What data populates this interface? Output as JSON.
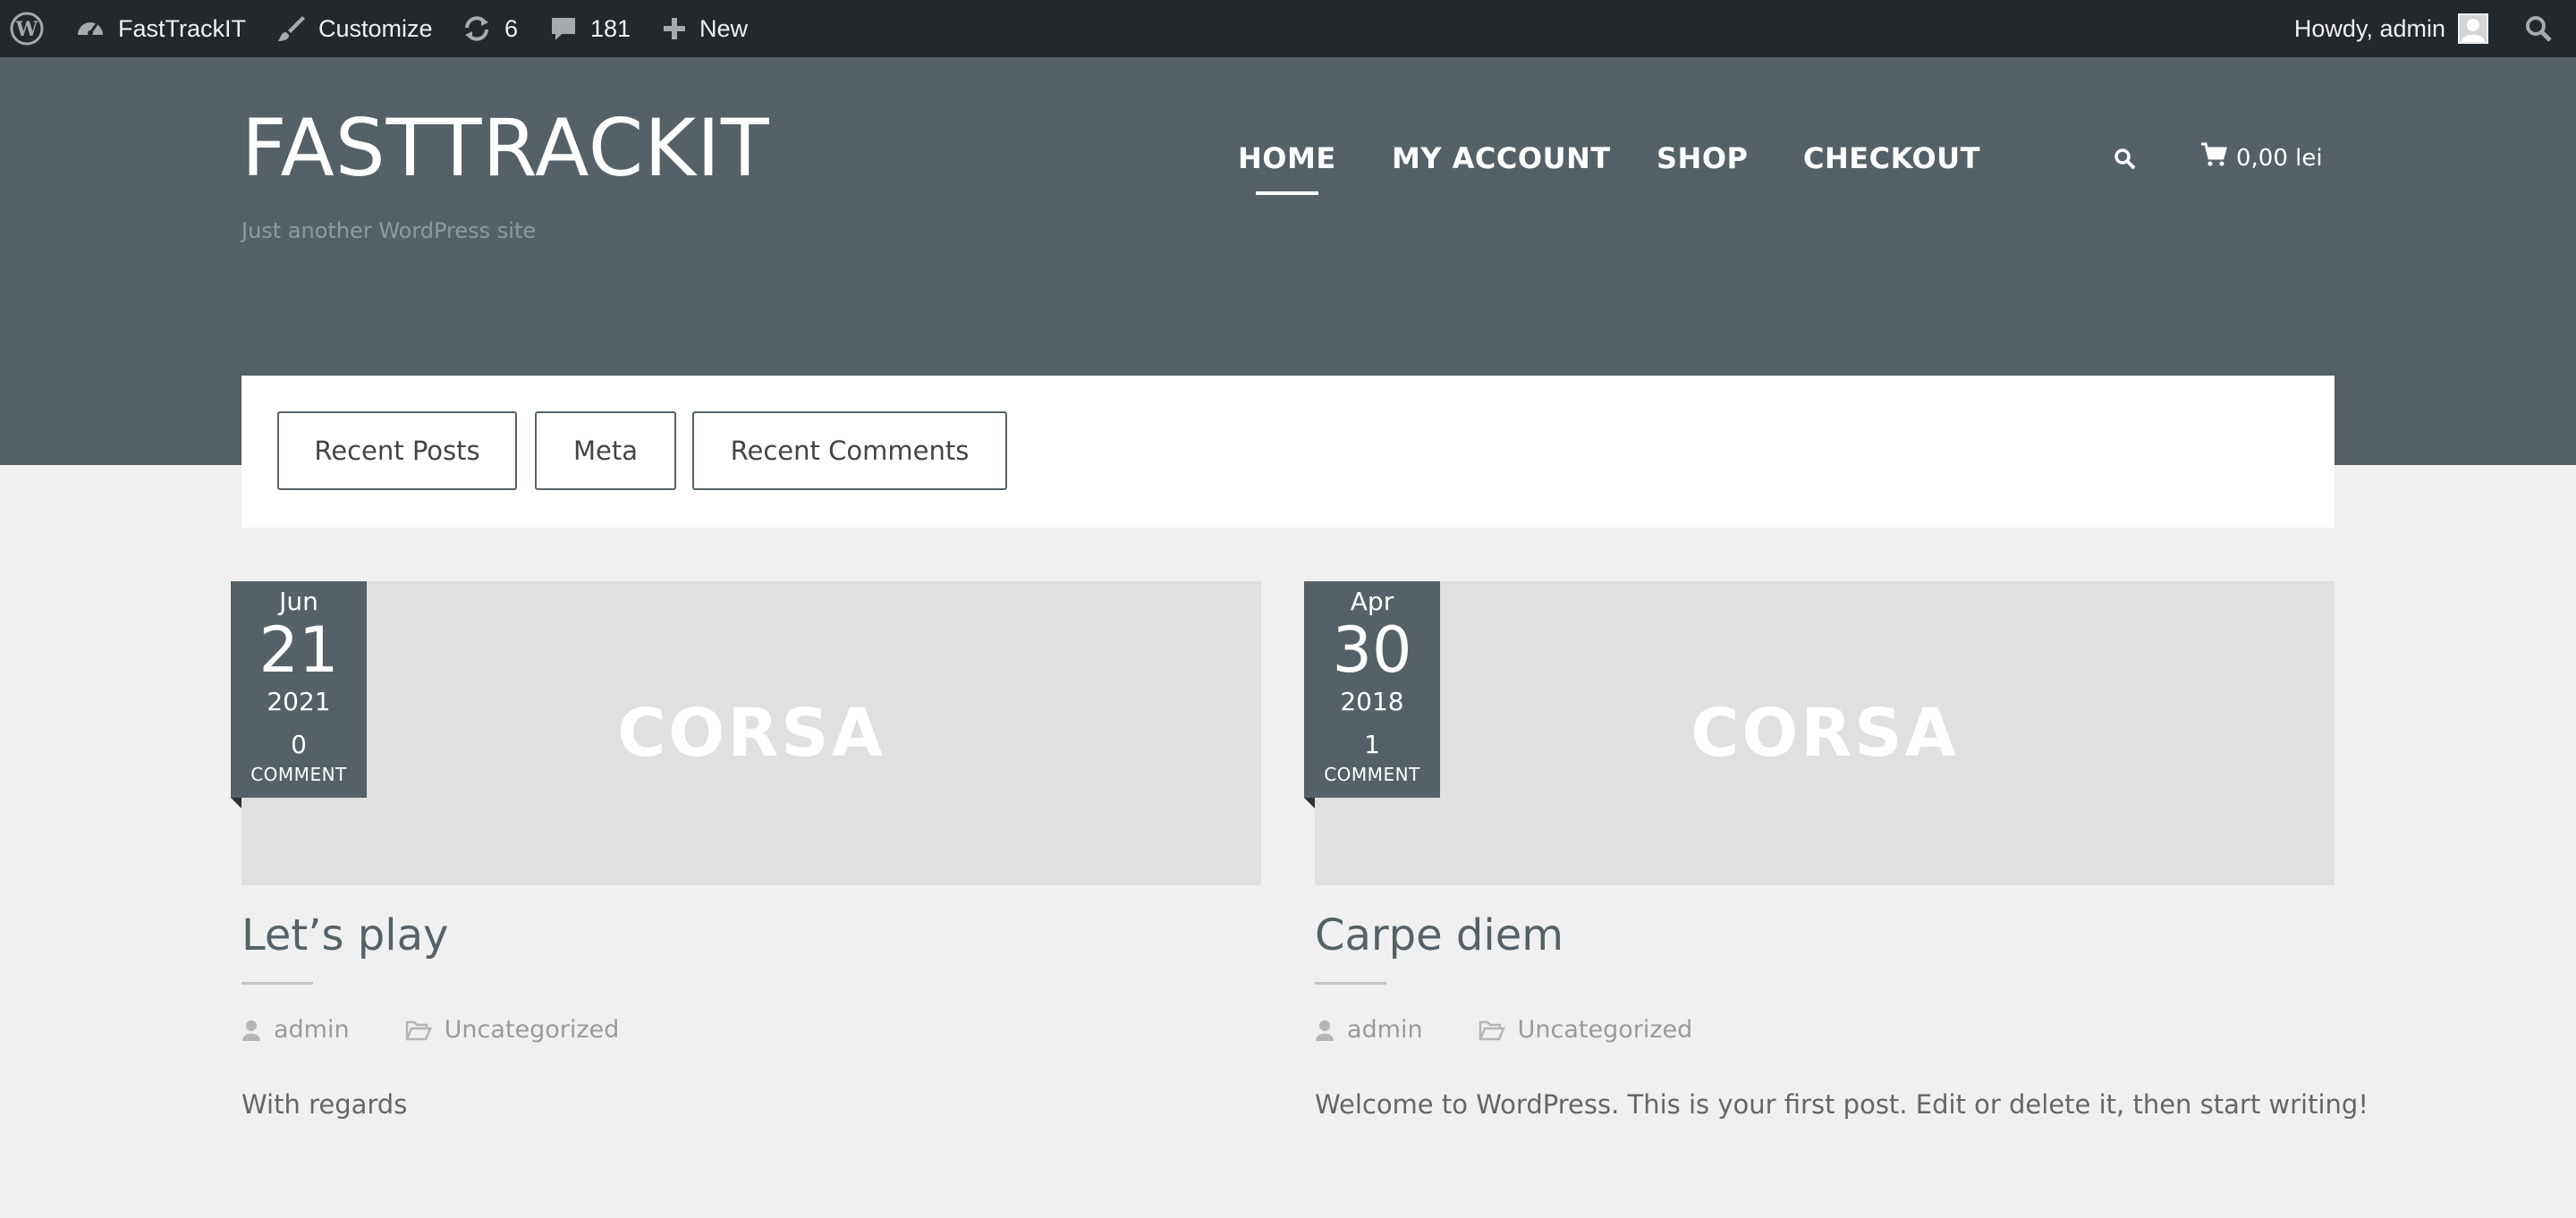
{
  "admin_bar": {
    "site_name": "FastTrackIT",
    "customize_label": "Customize",
    "updates_count": "6",
    "comments_count": "181",
    "new_label": "New",
    "howdy_text": "Howdy, admin"
  },
  "header": {
    "site_title": "FASTTRACKIT",
    "site_description": "Just another WordPress site",
    "nav": [
      {
        "label": "HOME",
        "active": true
      },
      {
        "label": "MY ACCOUNT",
        "active": false
      },
      {
        "label": "SHOP",
        "active": false
      },
      {
        "label": "CHECKOUT",
        "active": false
      }
    ],
    "cart_total": "0,00 lei"
  },
  "widget_tabs": [
    "Recent Posts",
    "Meta",
    "Recent Comments"
  ],
  "posts": [
    {
      "thumb_text": "CORSA",
      "month": "Jun",
      "day": "21",
      "year": "2021",
      "comment_count": "0",
      "comment_label": "COMMENT",
      "title": "Let’s play",
      "author": "admin",
      "category": "Uncategorized",
      "excerpt": "With regards"
    },
    {
      "thumb_text": "CORSA",
      "month": "Apr",
      "day": "30",
      "year": "2018",
      "comment_count": "1",
      "comment_label": "COMMENT",
      "title": "Carpe diem",
      "author": "admin",
      "category": "Uncategorized",
      "excerpt": "Welcome to WordPress. This is your first post. Edit or delete it, then start writing!"
    }
  ],
  "colors": {
    "admin_bar_bg": "#23282d",
    "header_bg": "#556167",
    "page_bg": "#f0f0f0",
    "thumb_bg": "#e0e0e0"
  }
}
